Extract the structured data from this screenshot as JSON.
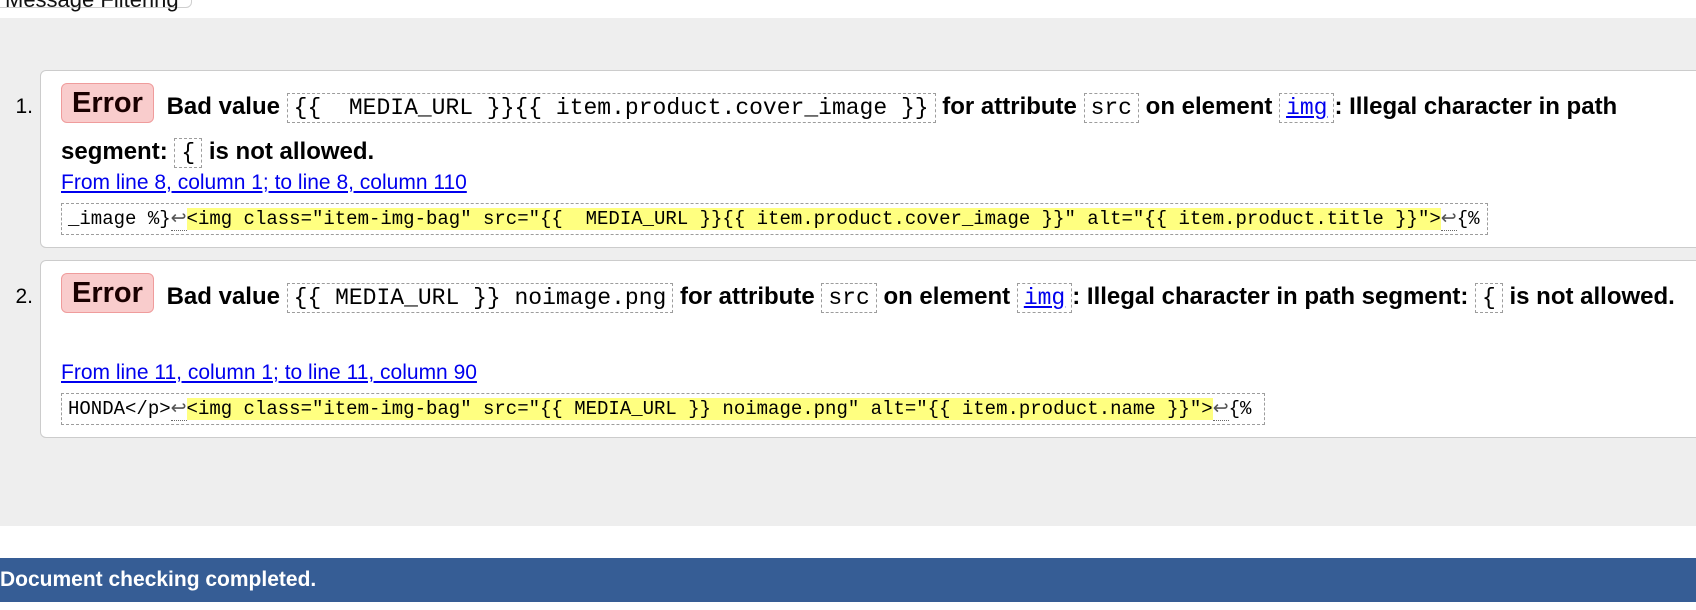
{
  "header": {
    "tab_label": "Message Filtering"
  },
  "messages": [
    {
      "number": "1.",
      "type": "Error",
      "t_bad_value": "Bad value",
      "value": "{{  MEDIA_URL }}{{ item.product.cover_image }}",
      "t_for_attribute": "for attribute",
      "attribute": "src",
      "t_on_element": "on element",
      "element": "img",
      "t_illegal": ": Illegal character in path segment:",
      "char": "{",
      "t_not_allowed": "is not allowed.",
      "location": "From line 8, column 1; to line 8, column 110",
      "extract_before": "_image %}",
      "extract_lf1": "↩",
      "extract_highlight": "<img class=\"item-img-bag\" src=\"{{  MEDIA_URL }}{{ item.product.cover_image }}\" alt=\"{{ item.product.title }}\">",
      "extract_lf2": "↩",
      "extract_after": "{% el"
    },
    {
      "number": "2.",
      "type": "Error",
      "t_bad_value": "Bad value",
      "value": "{{ MEDIA_URL }} noimage.png",
      "t_for_attribute": "for attribute",
      "attribute": "src",
      "t_on_element": "on element",
      "element": "img",
      "t_illegal": ": Illegal character in path segment:",
      "char": "{",
      "t_not_allowed": "is not allowed.",
      "location": "From line 11, column 1; to line 11, column 90",
      "extract_before": "HONDA</p>",
      "extract_lf1": "↩",
      "extract_highlight": "<img class=\"item-img-bag\" src=\"{{ MEDIA_URL }} noimage.png\" alt=\"{{ item.product.name }}\">",
      "extract_lf2": "↩",
      "extract_after": "{% en"
    }
  ],
  "status": {
    "text": "Document checking completed."
  },
  "colors": {
    "error_badge_bg": "#f9cccc",
    "highlight": "#ffff80",
    "status_bar": "#365d95",
    "link": "#0000ee"
  }
}
